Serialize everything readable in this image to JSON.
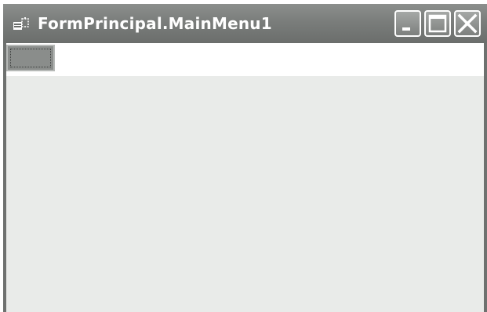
{
  "window": {
    "title": "FormPrincipal.MainMenu1",
    "icon": "form-app-icon"
  },
  "caption_buttons": [
    {
      "name": "minimize",
      "icon": "minimize-icon"
    },
    {
      "name": "maximize",
      "icon": "maximize-icon"
    },
    {
      "name": "close",
      "icon": "close-icon"
    }
  ],
  "menubar": {
    "placeholder_item": ""
  },
  "colors": {
    "titlebar": "#7a7d7b",
    "client_area": "#e9ebe9",
    "menubar": "#ffffff"
  }
}
